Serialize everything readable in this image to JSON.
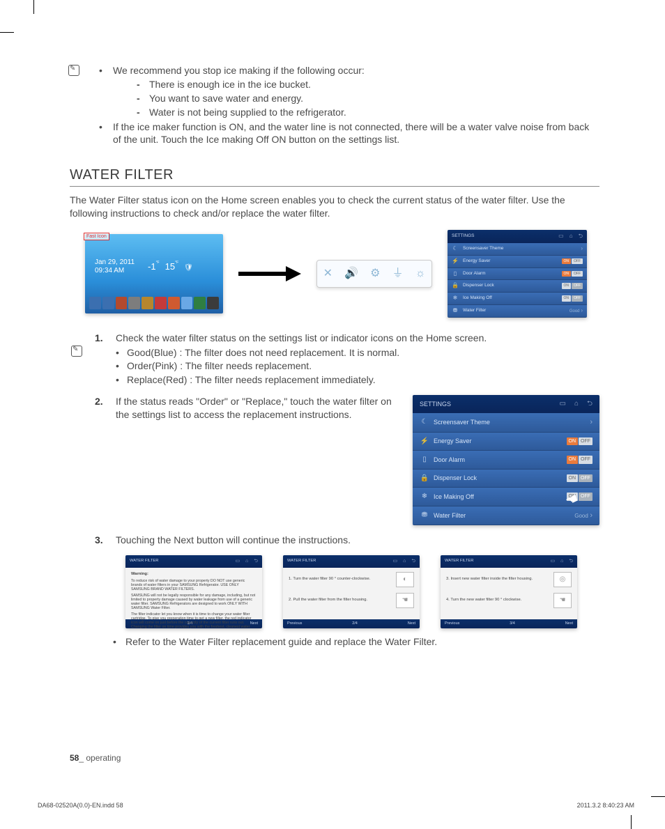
{
  "recommend": {
    "line1": "We recommend you stop ice making if the following occur:",
    "dash1": "There is enough ice in the ice bucket.",
    "dash2": "You want to save water and energy.",
    "dash3": "Water is not being supplied to the refrigerator.",
    "line2": "If the ice maker function is ON, and the water line is not connected, there will be a water valve noise from back of the unit. Touch the Ice making Off ON button on the settings list."
  },
  "section_title": "WATER FILTER",
  "intro": "The Water Filter status icon on the Home screen enables you to check the current status of the water filter. Use the following instructions to check and/or replace the water filter.",
  "home": {
    "fast_icon": "Fast Icon",
    "date": "Jan 29, 2011",
    "time": "09:34 AM",
    "t1": "-1",
    "t1u": "°F",
    "t2": "15",
    "t2u": "°F"
  },
  "apps": [
    "#3b6fb0",
    "#3b6fb0",
    "#b34a2e",
    "#7d7d7d",
    "#b6862d",
    "#c33a3a",
    "#cf5a30",
    "#6aa8e6",
    "#2f7e41",
    "#3b3b3b"
  ],
  "strip_icons": [
    "✕",
    "🔊",
    "⚙",
    "⏚",
    "☼"
  ],
  "settings": {
    "title": "SETTINGS",
    "rows": {
      "screensaver": "Screensaver Theme",
      "energy": "Energy Saver",
      "door": "Door Alarm",
      "dispenser": "Dispenser Lock",
      "ice": "Ice Making Off",
      "water": "Water Filter"
    },
    "on": "ON",
    "off": "OFF",
    "good": "Good"
  },
  "step1": {
    "text": "Check the water filter status on the settings list or indicator icons on the Home screen.",
    "b1": "Good(Blue) : The filter does not need replacement. It is normal.",
    "b2": "Order(Pink) : The filter needs replacement.",
    "b3": "Replace(Red) : The filter needs replacement immediately."
  },
  "step2": "If the status reads \"Order\" or \"Replace,\" touch the water filter on the settings list to access the replacement instructions.",
  "step3": "Touching the Next button will continue the instructions.",
  "wf": {
    "title": "WATER FILTER",
    "warn": "Warning:",
    "w1": "To reduce risk of water damage to your property DO NOT use generic brands of water filters in your SAMSUNG Refrigerator. USE ONLY SAMSUNG BRAND WATER FILTERS.",
    "w2": "SAMSUNG will not be legally responsible for any damage, including, but not limited to property damage caused by water leakage from use of a generic water filter. SAMSUNG Refrigerators are designed to work ONLY WITH SAMSUNG Water Filter.",
    "w3": "The filter indicator let you know when it is time to change your water filter cartridge. To give you preperation time to get a new filter, the red indicator icon will come on just before the capacity of the current filter runs out. Changing the filter on time provides you with the freshest, cleanest water from your fridge.",
    "p1": "1/4",
    "s2a": "1. Turn the water filter 90 ° counter-clockwise.",
    "s2b": "2. Pull the water filter from the filter housing.",
    "p2": "2/4",
    "s3a": "3. Insert new water filter inside the filter housing.",
    "s3b": "4. Turn the new water filter 90 ° clockwise.",
    "p3": "3/4",
    "prev": "Previous",
    "next": "Next"
  },
  "final": "Refer to the Water Filter replacement guide and replace the Water Filter.",
  "footer": {
    "num": "58",
    "label": "_ operating"
  },
  "indd": {
    "left": "DA68-02520A(0.0)-EN.indd   58",
    "right": "2011.3.2   8:40:23 AM"
  }
}
